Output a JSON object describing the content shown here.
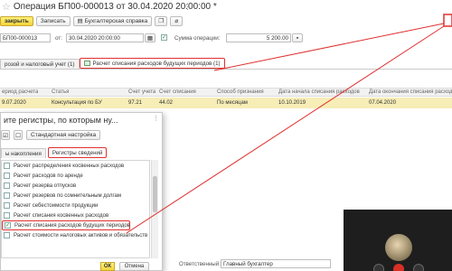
{
  "window": {
    "title": "Операция БП00-000013 от 30.04.2020 20:00:00 *",
    "menu_dots": "⋮"
  },
  "toolbar": {
    "close_label": "закрыть",
    "save_label": "Записать",
    "print_label": "Бухгалтерская справка"
  },
  "header": {
    "number": "БП00-000013",
    "date_label": "от:",
    "date_value": "30.04.2020 20:00:00",
    "sum_label": "Сумма операции:",
    "sum_value": "5 200.00"
  },
  "tabs": [
    {
      "label": "розой и налоговый учет (1)"
    },
    {
      "label": "Расчет списания расходов будущих периодов (1)"
    }
  ],
  "table": {
    "columns": [
      "ериод расчета",
      "Статья",
      "Счет учета",
      "Счет списания",
      "Способ признания",
      "Дата начала списания расходов",
      "Дата окончания списания расходов"
    ],
    "rows": [
      [
        "9.07.2020",
        "Консультация по БУ",
        "97.21",
        "44.02",
        "По месяцам",
        "10.10.2019",
        "07.04.2020"
      ]
    ]
  },
  "dialog": {
    "title": "ите регистры, по которым ну...",
    "toolbar_button": "Стандартная настройка",
    "tabs": [
      "ы накопления",
      "Регистры сведений"
    ],
    "items": [
      "Расчет распределения косвенных расходов",
      "Расчет расходов по аренде",
      "Расчет резерва отпусков",
      "Расчет резервов по сомнительным долгам",
      "Расчет себестоимости продукции",
      "Расчет списания косвенных расходов",
      "Расчет списания расходов будущих периодов",
      "Расчет стоимости налоговых активов и обязательств"
    ],
    "ok_label": "ОК",
    "cancel_label": "Отмена"
  },
  "footer": {
    "responsible_label": "Ответственный:",
    "responsible_value": "Главный бухгалтер"
  },
  "colors": {
    "highlight_red": "#e03030",
    "selected_row": "#f7edb6",
    "primary_button": "#f3d33a"
  }
}
